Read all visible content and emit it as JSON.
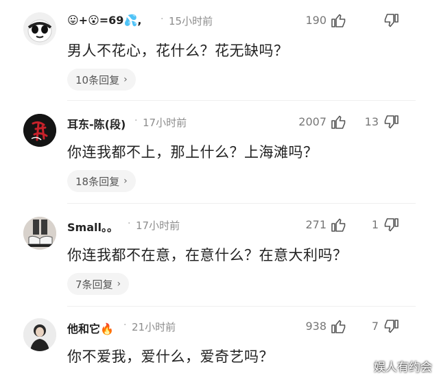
{
  "comments": [
    {
      "username": "😛+😮=69💦,",
      "time": "15小时前",
      "likes": "190",
      "dislikes": "",
      "text": "男人不花心，花什么？花无缺吗？",
      "replies": "10条回复"
    },
    {
      "username": "耳东-陈(段)",
      "time": "17小时前",
      "likes": "2007",
      "dislikes": "13",
      "text": "你连我都不上，那上什么？上海滩吗？",
      "replies": "18条回复"
    },
    {
      "username": "Small。。",
      "time": "17小时前",
      "likes": "271",
      "dislikes": "1",
      "text": "你连我都不在意，在意什么？在意大利吗？",
      "replies": "7条回复"
    },
    {
      "username": "他和它🔥",
      "time": "21小时前",
      "likes": "938",
      "dislikes": "7",
      "text": "你不爱我，爱什么，爱奇艺吗？",
      "replies": ""
    }
  ],
  "watermark": "娱人有约会",
  "icons": {
    "like": "thumbs-up-icon",
    "dislike": "thumbs-down-icon",
    "chevron": "chevron-right-icon"
  }
}
